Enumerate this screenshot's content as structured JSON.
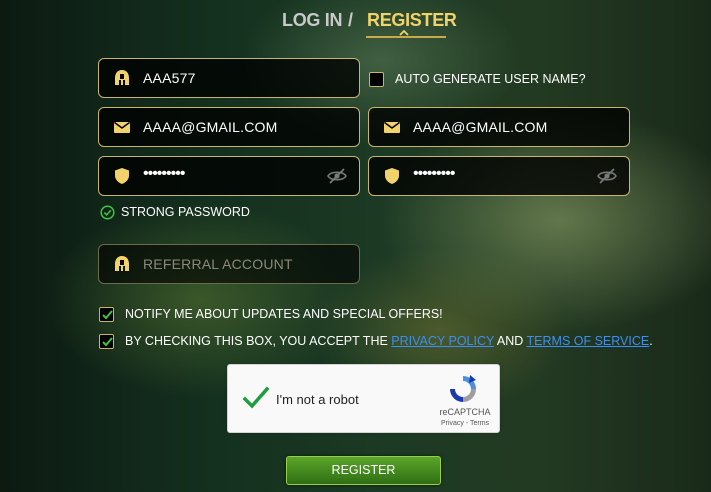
{
  "tabs": {
    "login": "LOG IN",
    "separator": "/",
    "register": "REGISTER",
    "active": "register"
  },
  "form": {
    "username": {
      "value": "AAA577",
      "icon": "helmet-icon"
    },
    "auto_generate_label": "AUTO GENERATE USER NAME?",
    "auto_generate_checked": false,
    "email": {
      "value": "AAAA@GMAIL.COM",
      "icon": "envelope-icon"
    },
    "email_confirm": {
      "value": "AAAA@GMAIL.COM",
      "icon": "envelope-icon"
    },
    "password": {
      "value": "•••••••••",
      "icon": "shield-icon"
    },
    "password_confirm": {
      "value": "•••••••••",
      "icon": "shield-icon"
    },
    "password_strength": "STRONG PASSWORD",
    "referral": {
      "placeholder": "REFERRAL ACCOUNT",
      "value": "",
      "icon": "helmet-icon"
    },
    "notify_label": "NOTIFY ME ABOUT UPDATES AND SPECIAL OFFERS!",
    "notify_checked": true,
    "terms_prefix": "BY CHECKING THIS BOX, YOU ACCEPT THE ",
    "privacy_link": "PRIVACY POLICY",
    "terms_and": " AND ",
    "terms_link": "TERMS OF SERVICE",
    "terms_suffix": ".",
    "terms_checked": true
  },
  "captcha": {
    "label": "I'm not a robot",
    "brand": "reCAPTCHA",
    "links": "Privacy - Terms",
    "checked": true
  },
  "submit_label": "REGISTER",
  "colors": {
    "accent_gold": "#f2d36b",
    "field_border": "#c9b46a",
    "check_green": "#2e9e2e",
    "link_blue": "#3d8ff0",
    "button_green": "#5aa62a"
  }
}
